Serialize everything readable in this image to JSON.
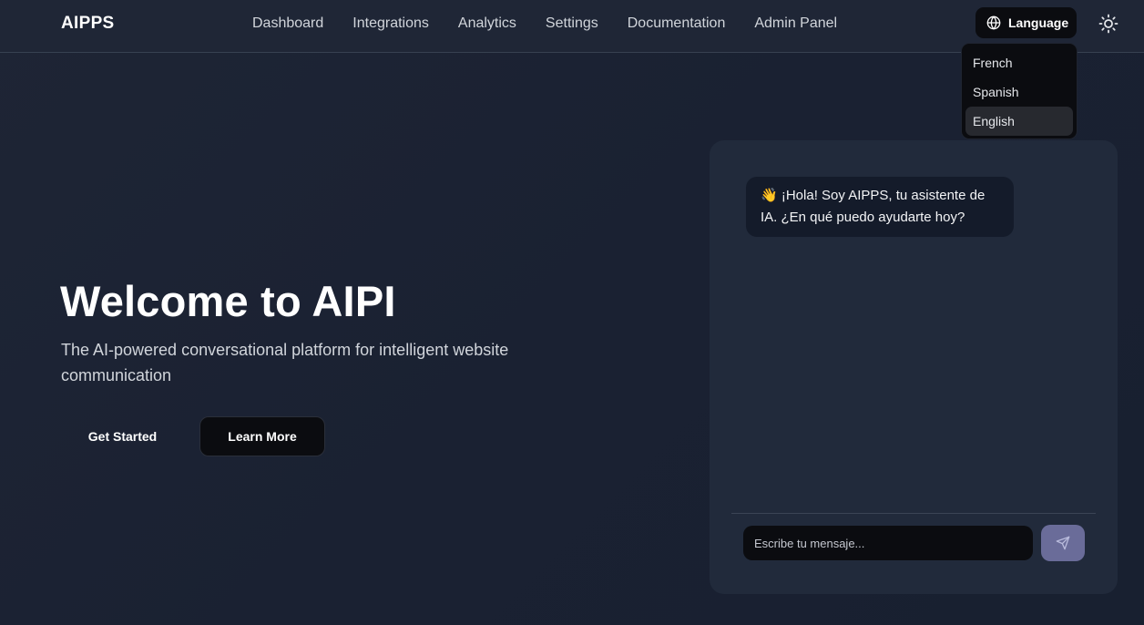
{
  "navbar": {
    "brand": "AIPPS",
    "links": [
      "Dashboard",
      "Integrations",
      "Analytics",
      "Settings",
      "Documentation",
      "Admin Panel"
    ],
    "language_label": "Language"
  },
  "language_menu": {
    "options": [
      "French",
      "Spanish",
      "English"
    ],
    "selected": "English"
  },
  "hero": {
    "title": "Welcome to AIPI",
    "subtitle": "The AI-powered conversational platform for intelligent website communication",
    "primary_button": "Get Started",
    "secondary_button": "Learn More"
  },
  "chat": {
    "bot_message": "👋 ¡Hola! Soy AIPPS, tu asistente de IA. ¿En qué puedo ayudarte hoy?",
    "input_placeholder": "Escribe tu mensaje..."
  },
  "icons": {
    "language": "globe-icon",
    "theme": "sun-icon",
    "send": "send-icon"
  },
  "colors": {
    "background": "#1e2535",
    "panel": "#212a3b",
    "send_button": "#6a6c99",
    "dark_button": "#0b0c10"
  }
}
